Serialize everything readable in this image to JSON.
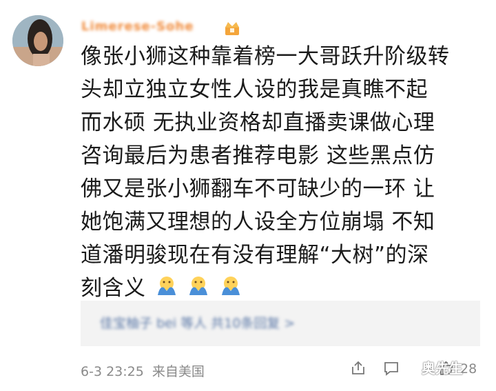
{
  "comment": {
    "username": "Limerese-Sohe",
    "text_lines": [
      "像张小狮这种靠着榜一大哥跃升阶级转",
      "头却立独立女性人设的我是真瞧不起",
      "而水硕 无执业资格却直播卖课做心理",
      "咨询最后为患者推荐电影 这些黑点仿",
      "佛又是张小狮翻车不可缺少的一环 让",
      "她饱满又理想的人设全方位崩塌 不知",
      "道潘明骏现在有没有理解“大树”的深",
      "刻含义"
    ],
    "emoji": [
      "hands-over-face-emoji",
      "hands-over-face-emoji",
      "hands-over-face-emoji"
    ],
    "reply_preview": "佳宝柚子 bei 等人 共10条回复 >",
    "timestamp": "6-3 23:25",
    "source": "来自美国",
    "like_count": "28"
  },
  "icons": {
    "vip": "vip-crown-icon",
    "share": "share-icon",
    "comment": "comment-icon",
    "like": "like-icon"
  },
  "watermark": "奥先生",
  "colors": {
    "username": "#f08a3a",
    "reply_link": "#5c79a8",
    "meta": "#8a8a8a",
    "reply_bg": "#f3f3f3"
  }
}
